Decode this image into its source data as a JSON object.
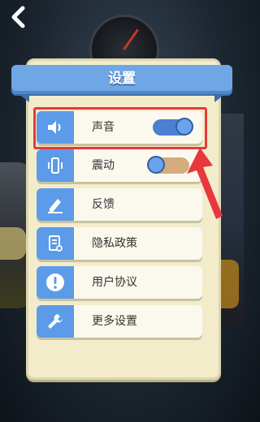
{
  "header": {
    "back_icon": "chevron-left-icon"
  },
  "dialog": {
    "title": "设置"
  },
  "settings": [
    {
      "label": "声音",
      "icon": "speaker-icon",
      "toggle": true,
      "state": "on"
    },
    {
      "label": "震动",
      "icon": "vibrate-icon",
      "toggle": true,
      "state": "off"
    },
    {
      "label": "反馈",
      "icon": "pencil-icon"
    },
    {
      "label": "隐私政策",
      "icon": "document-icon"
    },
    {
      "label": "用户协议",
      "icon": "alert-icon"
    },
    {
      "label": "更多设置",
      "icon": "wrench-icon"
    }
  ],
  "colors": {
    "accent": "#5b9be8",
    "highlight": "#e8383d",
    "panel": "#f3eccb"
  }
}
